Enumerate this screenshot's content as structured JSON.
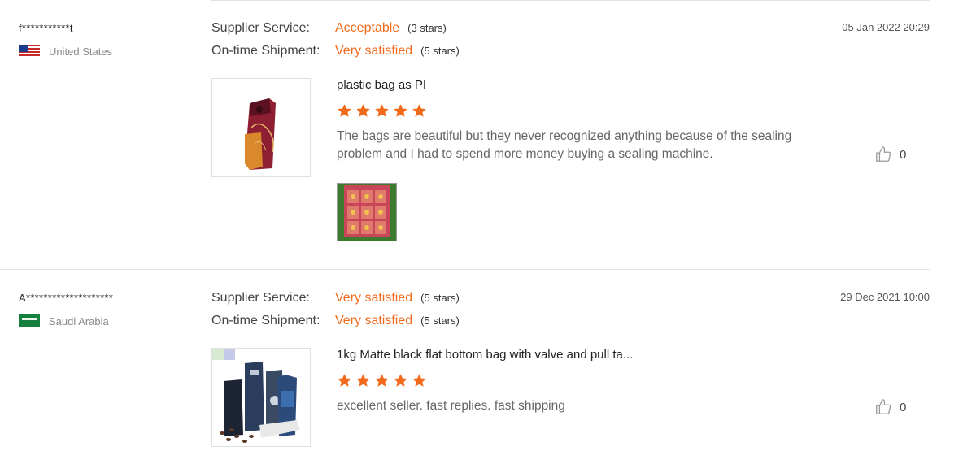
{
  "reviews": [
    {
      "user": "f***********t",
      "country": "United States",
      "flag_icon": "us-flag-icon",
      "ratings": [
        {
          "label": "Supplier Service:",
          "value": "Acceptable",
          "stars_text": "(3 stars)"
        },
        {
          "label": "On-time Shipment:",
          "value": "Very satisfied",
          "stars_text": "(5 stars)"
        }
      ],
      "date": "05 Jan 2022 20:29",
      "product_title": "plastic bag as PI",
      "product_stars": 5,
      "text": "The bags are beautiful but they never recognized anything because of the sealing problem and I had to spend more money buying a sealing machine.",
      "likes": "0"
    },
    {
      "user": "A********************",
      "country": "Saudi Arabia",
      "flag_icon": "saudi-flag-icon",
      "ratings": [
        {
          "label": "Supplier Service:",
          "value": "Very satisfied",
          "stars_text": "(5 stars)"
        },
        {
          "label": "On-time Shipment:",
          "value": "Very satisfied",
          "stars_text": "(5 stars)"
        }
      ],
      "date": "29 Dec 2021 10:00",
      "product_title": "1kg Matte black flat bottom bag with valve and pull ta...",
      "product_stars": 5,
      "text": "excellent seller. fast replies. fast shipping",
      "likes": "0"
    }
  ],
  "colors": {
    "accent": "#f26b1d",
    "star": "#f26b1d",
    "divider": "#e2e2e2"
  }
}
